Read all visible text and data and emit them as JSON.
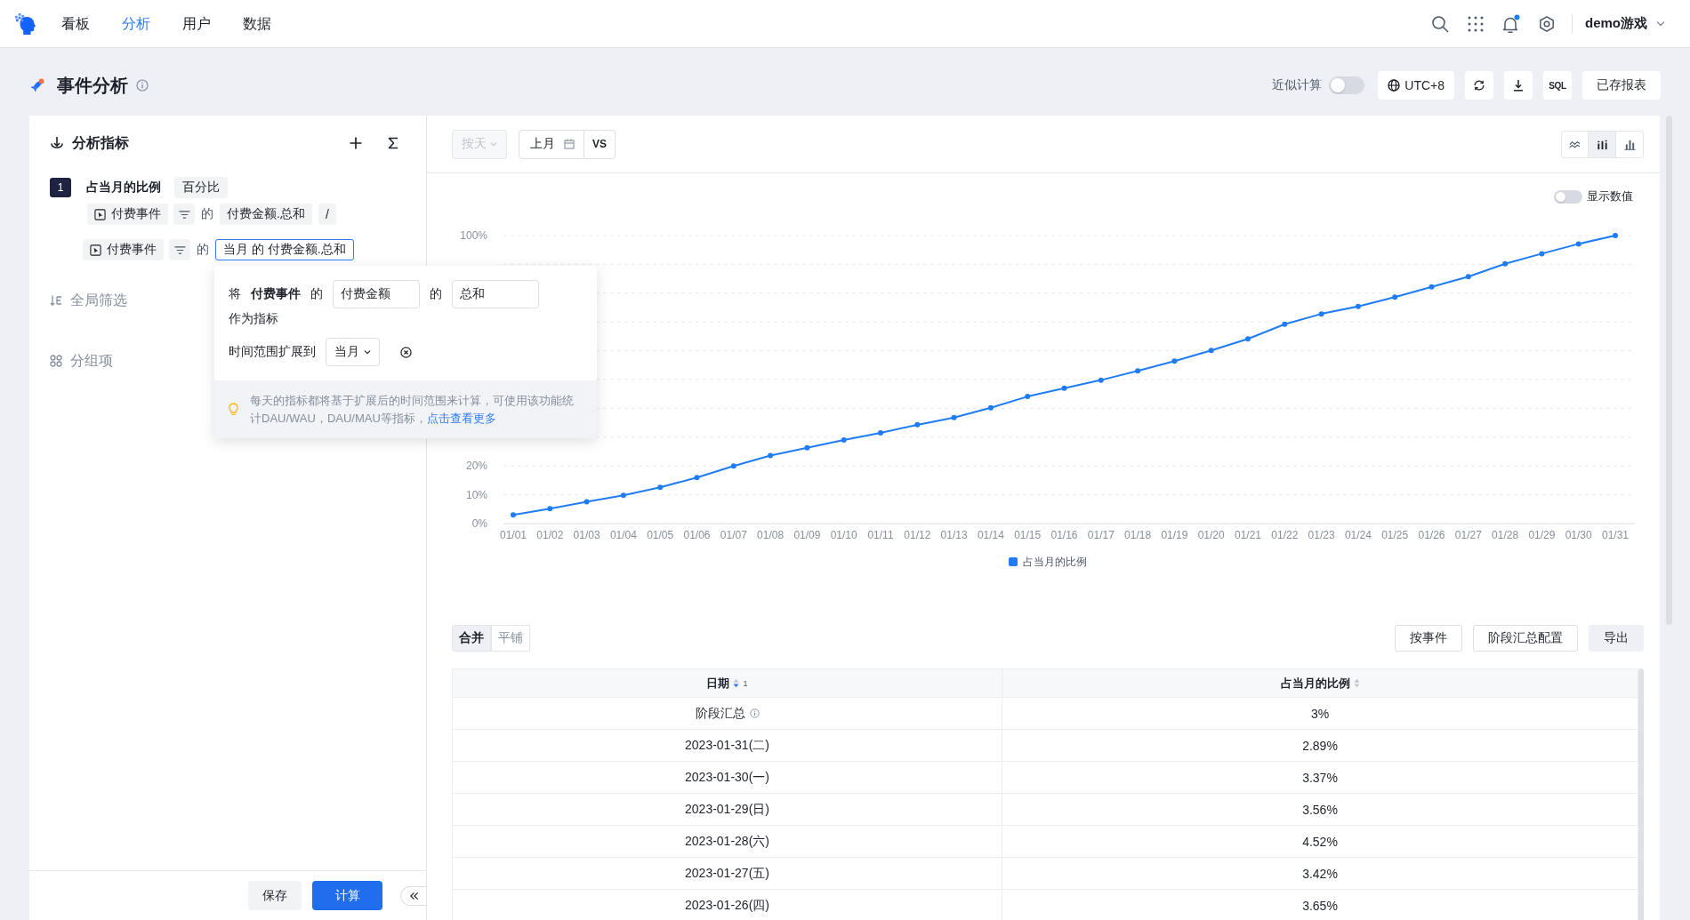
{
  "top_nav": {
    "items": [
      {
        "label": "看板",
        "selected": false
      },
      {
        "label": "分析",
        "selected": true
      },
      {
        "label": "用户",
        "selected": false
      },
      {
        "label": "数据",
        "selected": false
      }
    ],
    "has_unread": true,
    "project": "demo游戏"
  },
  "header": {
    "title": "事件分析",
    "approx_label": "近似计算",
    "approx_on": false,
    "timezone": "UTC+8",
    "sql": "SQL",
    "saved_reports": "已存报表"
  },
  "metrics_panel": {
    "title": "分析指标",
    "metrics": [
      {
        "index": "1",
        "name": "占当月的比例",
        "format": "百分比",
        "terms": [
          {
            "event": "付费事件",
            "connector": "的",
            "measure": "付费金额.总和",
            "selected": false,
            "operator": "/"
          },
          {
            "event": "付费事件",
            "connector": "的",
            "measure": "当月 的 付费金额.总和",
            "selected": true
          }
        ]
      }
    ],
    "sections": [
      {
        "kind": "filter",
        "label": "全局筛选"
      },
      {
        "kind": "group",
        "label": "分组项"
      }
    ],
    "save": "保存",
    "compute": "计算"
  },
  "popover": {
    "prefix": "将",
    "event": "付费事件",
    "connector_1": "的",
    "field": "付费金额",
    "connector_2": "的",
    "aggregate": "总和",
    "suffix": "作为指标",
    "extend_label": "时间范围扩展到",
    "extend_value": "当月",
    "tip": "每天的指标都将基于扩展后的时间范围来计算，可使用该功能统计DAU/WAU，DAU/MAU等指标，",
    "tip_link": "点击查看更多"
  },
  "chart_toolbar": {
    "granularity": "按天",
    "granularity_disabled": true,
    "date_range": "上月",
    "compare": "VS",
    "chart_types": [
      {
        "kind": "trend",
        "selected": false
      },
      {
        "kind": "grouped",
        "selected": true
      },
      {
        "kind": "bar",
        "selected": false
      }
    ]
  },
  "chart_area": {
    "show_values": {
      "label": "显示数值",
      "on": false
    },
    "chart_data": {
      "type": "line",
      "categories": [
        "01/01",
        "01/02",
        "01/03",
        "01/04",
        "01/05",
        "01/06",
        "01/07",
        "01/08",
        "01/09",
        "01/10",
        "01/11",
        "01/12",
        "01/13",
        "01/14",
        "01/15",
        "01/16",
        "01/17",
        "01/18",
        "01/19",
        "01/20",
        "01/21",
        "01/22",
        "01/23",
        "01/24",
        "01/25",
        "01/26",
        "01/27",
        "01/28",
        "01/29",
        "01/30",
        "01/31"
      ],
      "series": [
        {
          "name": "占当月的比例",
          "color": "#1f7cf5",
          "marker": true,
          "values": [
            3.0,
            5.2,
            7.6,
            9.8,
            12.6,
            16.0,
            20.0,
            23.6,
            26.3,
            29.0,
            31.5,
            34.3,
            36.8,
            40.2,
            44.1,
            47.0,
            49.8,
            53.0,
            56.4,
            60.1,
            64.1,
            69.2,
            72.8,
            75.4,
            78.6,
            82.2,
            85.7,
            90.2,
            93.7,
            97.1,
            100
          ]
        }
      ],
      "ylim": [
        0,
        100
      ],
      "yticks": [
        {
          "value": 0,
          "label": "0%"
        },
        {
          "value": 10,
          "label": "10%"
        },
        {
          "value": 20,
          "label": "20%"
        },
        {
          "value": 100,
          "label": "100%"
        }
      ]
    }
  },
  "table_toolbar": {
    "views": [
      {
        "label": "合并",
        "selected": true
      },
      {
        "label": "平铺",
        "selected": false
      }
    ],
    "buttons": [
      {
        "label": "按事件",
        "kind": "outline"
      },
      {
        "label": "阶段汇总配置",
        "kind": "outline"
      },
      {
        "label": "导出",
        "kind": "filled"
      }
    ]
  },
  "table": {
    "columns": [
      {
        "label": "日期",
        "sorted": true,
        "descending": true,
        "sort_rank": "1"
      },
      {
        "label": "占当月的比例",
        "sorted": false
      }
    ],
    "rows": [
      {
        "kind": "summary",
        "cells": [
          "阶段汇总",
          "3%"
        ]
      },
      {
        "kind": "day",
        "cells": [
          "2023-01-31(二)",
          "2.89%"
        ]
      },
      {
        "kind": "day",
        "cells": [
          "2023-01-30(一)",
          "3.37%"
        ]
      },
      {
        "kind": "day",
        "cells": [
          "2023-01-29(日)",
          "3.56%"
        ]
      },
      {
        "kind": "day",
        "cells": [
          "2023-01-28(六)",
          "4.52%"
        ]
      },
      {
        "kind": "day",
        "cells": [
          "2023-01-27(五)",
          "3.42%"
        ]
      },
      {
        "kind": "day",
        "cells": [
          "2023-01-26(四)",
          "3.65%"
        ]
      }
    ]
  }
}
